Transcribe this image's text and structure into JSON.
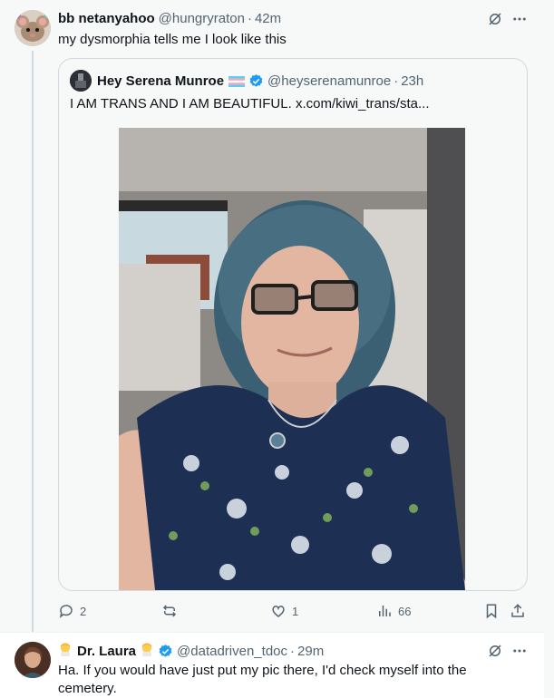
{
  "post1": {
    "author_name": "bb netanyahoo",
    "handle": "@hungryraton",
    "separator": "·",
    "time": "42m",
    "text": "my dysmorphia tells me I look like this",
    "quote": {
      "author_name": "Hey Serena Munroe",
      "handle": "@heyserenamunroe",
      "separator": "·",
      "time": "23h",
      "text": "I AM TRANS AND I AM BEAUTIFUL.  x.com/kiwi_trans/sta..."
    },
    "actions": {
      "replies": "2",
      "reposts": "",
      "likes": "1",
      "views": "66"
    }
  },
  "post2": {
    "author_name": "Dr. Laura",
    "handle": "@datadriven_tdoc",
    "separator": "·",
    "time": "29m",
    "text": "Ha. If you would have just put my pic there, I'd check myself into the cemetery."
  },
  "colors": {
    "verified": "#1d9bf0",
    "secondary_text": "#536471",
    "border": "#cfd9de"
  },
  "icons": [
    "grok-icon",
    "more-icon",
    "reply-icon",
    "repost-icon",
    "like-icon",
    "views-icon",
    "bookmark-icon",
    "share-icon",
    "verified-badge-icon",
    "trans-flag-icon",
    "woman-emoji-icon"
  ]
}
